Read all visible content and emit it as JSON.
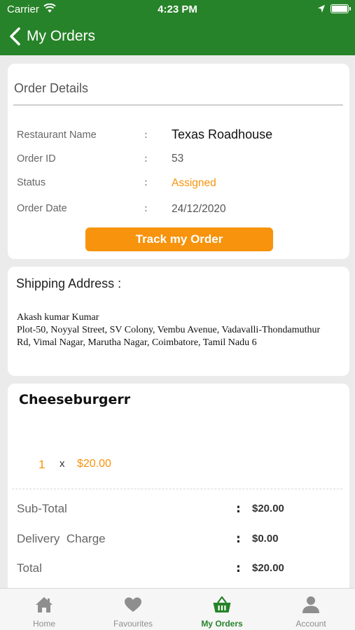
{
  "status_bar": {
    "carrier": "Carrier",
    "time": "4:23 PM"
  },
  "nav": {
    "title": "My Orders"
  },
  "order_details": {
    "title": "Order Details",
    "rows": [
      {
        "label": "Restaurant Name",
        "value": "Texas Roadhouse"
      },
      {
        "label": "Order ID",
        "value": "53"
      },
      {
        "label": "Status",
        "value": "Assigned"
      },
      {
        "label": "Order Date",
        "value": "24/12/2020"
      }
    ],
    "separator": ":",
    "track_button": "Track my Order"
  },
  "shipping": {
    "title": "Shipping Address :",
    "name": "Akash kumar Kumar",
    "address": "Plot-50, Noyyal Street, SV Colony, Vembu Avenue, Vadavalli-Thondamuthur Rd, Vimal Nagar, Marutha Nagar, Coimbatore, Tamil Nadu 6"
  },
  "item": {
    "name": "Cheeseburgerr",
    "quantity": "1",
    "times": "x",
    "price": "$20.00"
  },
  "summary": {
    "separator": ":",
    "rows": [
      {
        "label": "Sub-Total",
        "value": "$20.00"
      },
      {
        "label": "Delivery  Charge",
        "value": "$0.00"
      },
      {
        "label": "Total",
        "value": "$20.00"
      }
    ]
  },
  "tabbar": {
    "tabs": [
      {
        "label": "Home",
        "icon": "home-icon",
        "active": false
      },
      {
        "label": "Favourites",
        "icon": "heart-icon",
        "active": false
      },
      {
        "label": "My Orders",
        "icon": "basket-icon",
        "active": true
      },
      {
        "label": "Account",
        "icon": "person-icon",
        "active": false
      }
    ]
  },
  "colors": {
    "brand_green": "#278329",
    "accent_orange": "#f7930c",
    "inactive_gray": "#8e8e8e"
  }
}
